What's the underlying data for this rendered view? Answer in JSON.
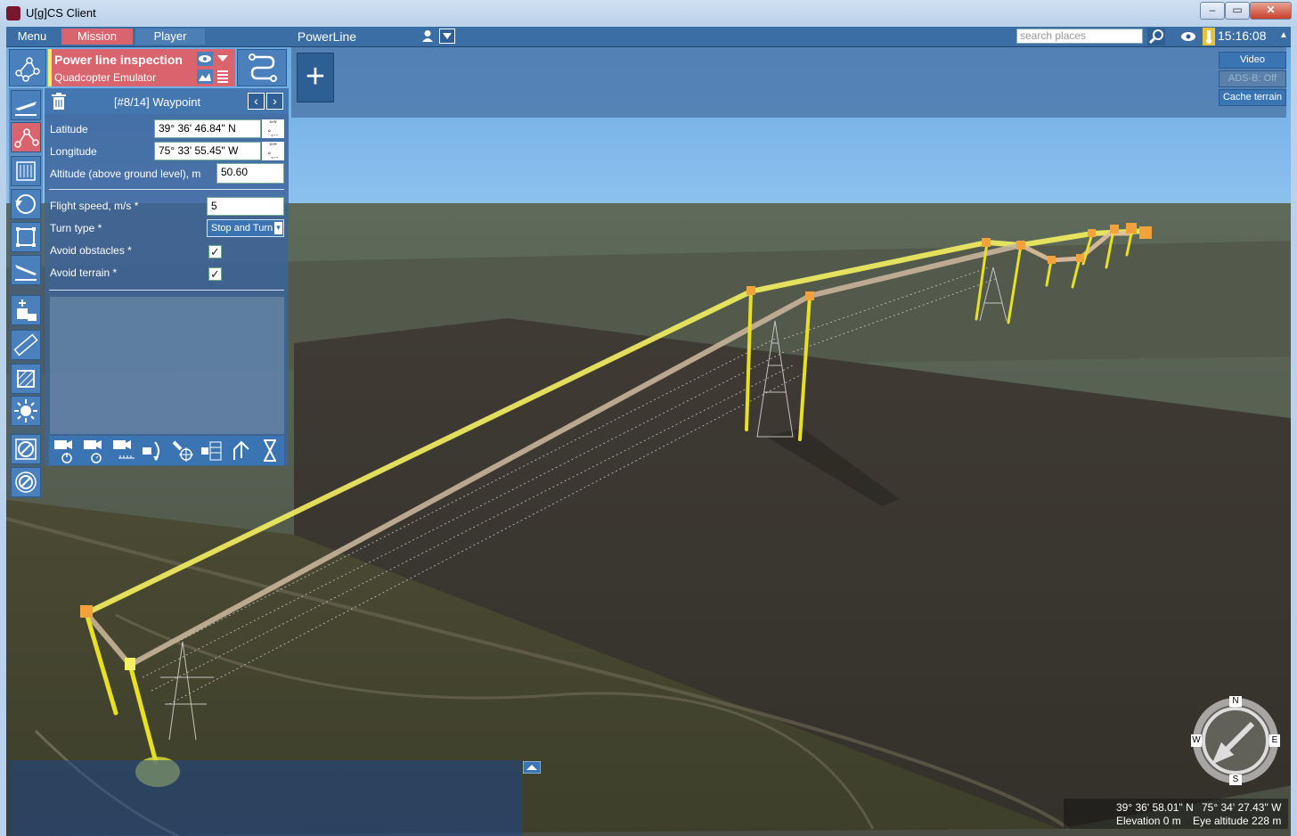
{
  "window": {
    "title": "U[g]CS Client"
  },
  "menubar": {
    "menu": "Menu",
    "mission": "Mission",
    "player": "Player",
    "mission_name": "PowerLine"
  },
  "search": {
    "placeholder": "search places"
  },
  "clock": "15:16:08",
  "mission_card": {
    "title": "Power line inspection",
    "vehicle": "Quadcopter Emulator"
  },
  "waypoint": {
    "header": "[#8/14] Waypoint",
    "latitude_label": "Latitude",
    "latitude_value": "39° 36' 46.84\" N",
    "longitude_label": "Longitude",
    "longitude_value": "75° 33' 55.45\" W",
    "altitude_label": "Altitude (above ground level), m",
    "altitude_value": "50.60",
    "speed_label": "Flight speed, m/s *",
    "speed_value": "5",
    "turn_label": "Turn type *",
    "turn_value": "Stop and Turn",
    "obstacles_label": "Avoid obstacles *",
    "terrain_label": "Avoid terrain *"
  },
  "right_buttons": {
    "video": "Video",
    "adsb": "ADS-B: Off",
    "cache": "Cache terrain"
  },
  "compass": {
    "n": "N",
    "s": "S",
    "e": "E",
    "w": "W"
  },
  "status": {
    "lat": "39° 36' 58.01\" N",
    "lon": "75° 34' 27.43\" W",
    "elevation": "Elevation 0 m",
    "eye": "Eye altitude 228 m"
  },
  "colors": {
    "mission_accent": "#d9646e",
    "route": "#f2ee5a",
    "panel": "#4a80bc"
  }
}
